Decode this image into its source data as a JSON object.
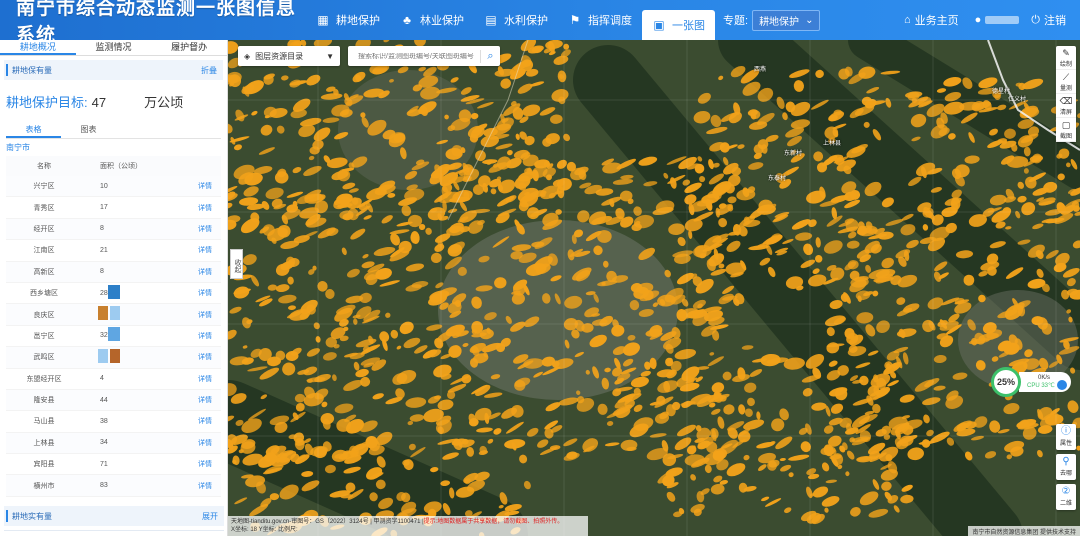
{
  "header": {
    "title": "南宁市综合动态监测一张图信息系统",
    "nav": [
      {
        "label": "耕地保护",
        "icon": "grid-icon"
      },
      {
        "label": "林业保护",
        "icon": "tree-icon"
      },
      {
        "label": "水利保护",
        "icon": "water-icon"
      },
      {
        "label": "指挥调度",
        "icon": "flag-icon"
      },
      {
        "label": "一张图",
        "icon": "map-icon"
      }
    ],
    "topic_label": "专题:",
    "topic_value": "耕地保护",
    "home_label": "业务主页",
    "logout_label": "注销"
  },
  "left": {
    "tabs": [
      "耕地概况",
      "监测情况",
      "履护督办"
    ],
    "section1": {
      "title": "耕地保有量",
      "toggle": "折叠"
    },
    "target": {
      "label": "耕地保护目标:",
      "value": "47",
      "unit": "万公顷"
    },
    "sub_tabs": [
      "表格",
      "图表"
    ],
    "region": "南宁市",
    "columns": {
      "name": "名称",
      "area": "面积（公顷）"
    },
    "rows": [
      {
        "name": "兴宁区",
        "area": "10",
        "op": "详情"
      },
      {
        "name": "青秀区",
        "area": "17",
        "op": "详情"
      },
      {
        "name": "经开区",
        "area": "8",
        "op": "详情"
      },
      {
        "name": "江南区",
        "area": "21",
        "op": "详情"
      },
      {
        "name": "高新区",
        "area": "8",
        "op": "详情"
      },
      {
        "name": "西乡塘区",
        "area": "28",
        "op": "详情"
      },
      {
        "name": "良庆区",
        "area": "20",
        "op": "详情"
      },
      {
        "name": "邕宁区",
        "area": "32",
        "op": "详情"
      },
      {
        "name": "武鸣区",
        "area": "58",
        "op": "详情"
      },
      {
        "name": "东盟经开区",
        "area": "4",
        "op": "详情"
      },
      {
        "name": "隆安县",
        "area": "44",
        "op": "详情"
      },
      {
        "name": "马山县",
        "area": "38",
        "op": "详情"
      },
      {
        "name": "上林县",
        "area": "34",
        "op": "详情"
      },
      {
        "name": "宾阳县",
        "area": "71",
        "op": "详情"
      },
      {
        "name": "横州市",
        "area": "83",
        "op": "详情"
      }
    ],
    "section2": {
      "title": "耕地实有量",
      "toggle": "展开"
    },
    "collapse_handle": "收起"
  },
  "map": {
    "layer_select": "图层资源目录",
    "search_placeholder": "搜索标识/监测图斑编号/关联图斑编号",
    "tools_top": [
      "绘制",
      "量测",
      "清屏",
      "截图"
    ],
    "tools_bottom": [
      "属性",
      "去哪",
      "二维"
    ],
    "cpu": {
      "percent": "25%",
      "speed": "0K/s",
      "temp": "CPU 33℃"
    },
    "attribution_line1": "天地图-tianditu.gov.cn-审图号：GS（2022）3124号 | 甲测资字1100471 |",
    "attribution_warn": "提示:地图数据属于共享数据，请勿截图、拍照外传。",
    "attribution_line2": "X坐标: 18            Y坐标:          比例尺:",
    "credit": "南宁市自然资源信息集团 提供技术支持",
    "places": [
      "西燕",
      "东新村",
      "上林县",
      "东泰村",
      "德星村",
      "仁义村"
    ]
  },
  "colors": {
    "accent": "#2a86e6",
    "farmland": "#f2a21a",
    "forest": "#2f4a2a"
  }
}
